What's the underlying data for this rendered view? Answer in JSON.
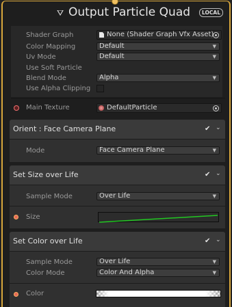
{
  "node": {
    "title": "Output Particle Quad",
    "badge": "LOCAL",
    "title_icon": "context-icon"
  },
  "properties": [
    {
      "label": "Shader Graph",
      "type": "object",
      "value": "None (Shader Graph Vfx Asset)"
    },
    {
      "label": "Color Mapping",
      "type": "dropdown",
      "value": "Default"
    },
    {
      "label": "Uv Mode",
      "type": "dropdown",
      "value": "Default"
    },
    {
      "label": "Use Soft Particle",
      "type": "none",
      "value": ""
    },
    {
      "label": "Blend Mode",
      "type": "dropdown",
      "value": "Alpha"
    },
    {
      "label": "Use Alpha Clipping",
      "type": "checkbox",
      "value": ""
    }
  ],
  "main_texture": {
    "label": "Main Texture",
    "value": "DefaultParticle"
  },
  "blocks": {
    "orient": {
      "title": "Orient : Face Camera Plane",
      "mode_label": "Mode",
      "mode_value": "Face Camera Plane"
    },
    "size": {
      "title": "Set Size over Life",
      "sample_label": "Sample Mode",
      "sample_value": "Over Life",
      "size_label": "Size"
    },
    "color": {
      "title": "Set Color over Life",
      "sample_label": "Sample Mode",
      "sample_value": "Over Life",
      "colormode_label": "Color Mode",
      "colormode_value": "Color And Alpha",
      "color_label": "Color"
    }
  },
  "glyphs": {
    "check": "✔",
    "chevron": "⌄",
    "arrow": "▼"
  },
  "colors": {
    "accent": "#d9a73c",
    "curve": "#22c822"
  }
}
